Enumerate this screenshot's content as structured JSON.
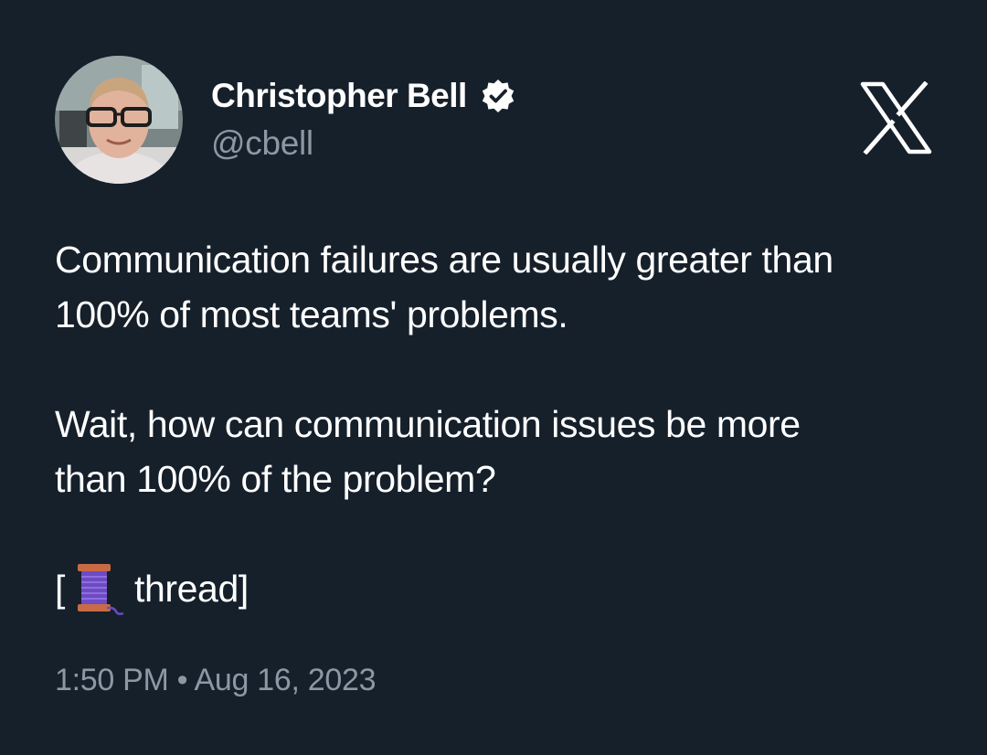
{
  "author": {
    "display_name": "Christopher Bell",
    "handle": "@cbell",
    "verified": true
  },
  "brand_logo": "x-logo",
  "tweet": {
    "line1": "Communication failures are usually greater than",
    "line2": "100% of most teams' problems.",
    "line3": "Wait, how can communication issues be more",
    "line4": "than 100% of the problem?",
    "thread_open": "[",
    "thread_emoji": "spool-of-thread",
    "thread_text": "thread]"
  },
  "timestamp": "1:50 PM • Aug 16, 2023",
  "colors": {
    "background": "#16202b",
    "primary_text": "#ffffff",
    "secondary_text": "#8b98a5"
  }
}
